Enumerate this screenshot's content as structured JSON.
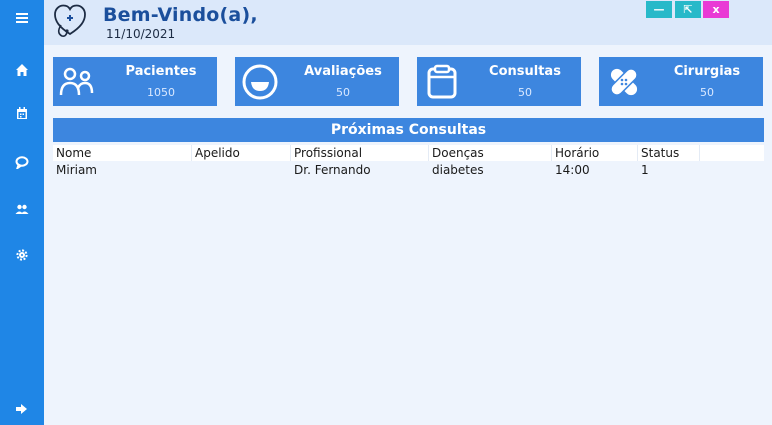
{
  "header": {
    "welcome": "Bem-Vindo(a),",
    "date": "11/10/2021"
  },
  "window_controls": {
    "minimize": "—",
    "maximize": "⇱",
    "close": "x"
  },
  "sidebar": {
    "items": [
      {
        "icon": "menu-icon"
      },
      {
        "icon": "home-icon"
      },
      {
        "icon": "calendar-icon"
      },
      {
        "icon": "chat-icon"
      },
      {
        "icon": "users-icon"
      },
      {
        "icon": "gear-icon"
      },
      {
        "icon": "logout-icon"
      }
    ]
  },
  "cards": [
    {
      "title": "Pacientes",
      "count": "1050",
      "icon": "patients-icon"
    },
    {
      "title": "Avaliações",
      "count": "50",
      "icon": "smile-icon"
    },
    {
      "title": "Consultas",
      "count": "50",
      "icon": "clipboard-icon"
    },
    {
      "title": "Cirurgias",
      "count": "50",
      "icon": "bandage-icon"
    }
  ],
  "table": {
    "title": "Próximas Consultas",
    "columns": [
      "Nome",
      "Apelido",
      "Profissional",
      "Doenças",
      "Horário",
      "Status"
    ],
    "rows": [
      [
        "Miriam",
        "",
        "Dr. Fernando",
        "diabetes",
        "14:00",
        "1"
      ]
    ]
  },
  "colors": {
    "sidebar": "#1f86e6",
    "accent": "#3d86df",
    "header_bg": "#dbe8fa",
    "page_bg": "#eef4fd",
    "title_text": "#1b4f9c"
  }
}
